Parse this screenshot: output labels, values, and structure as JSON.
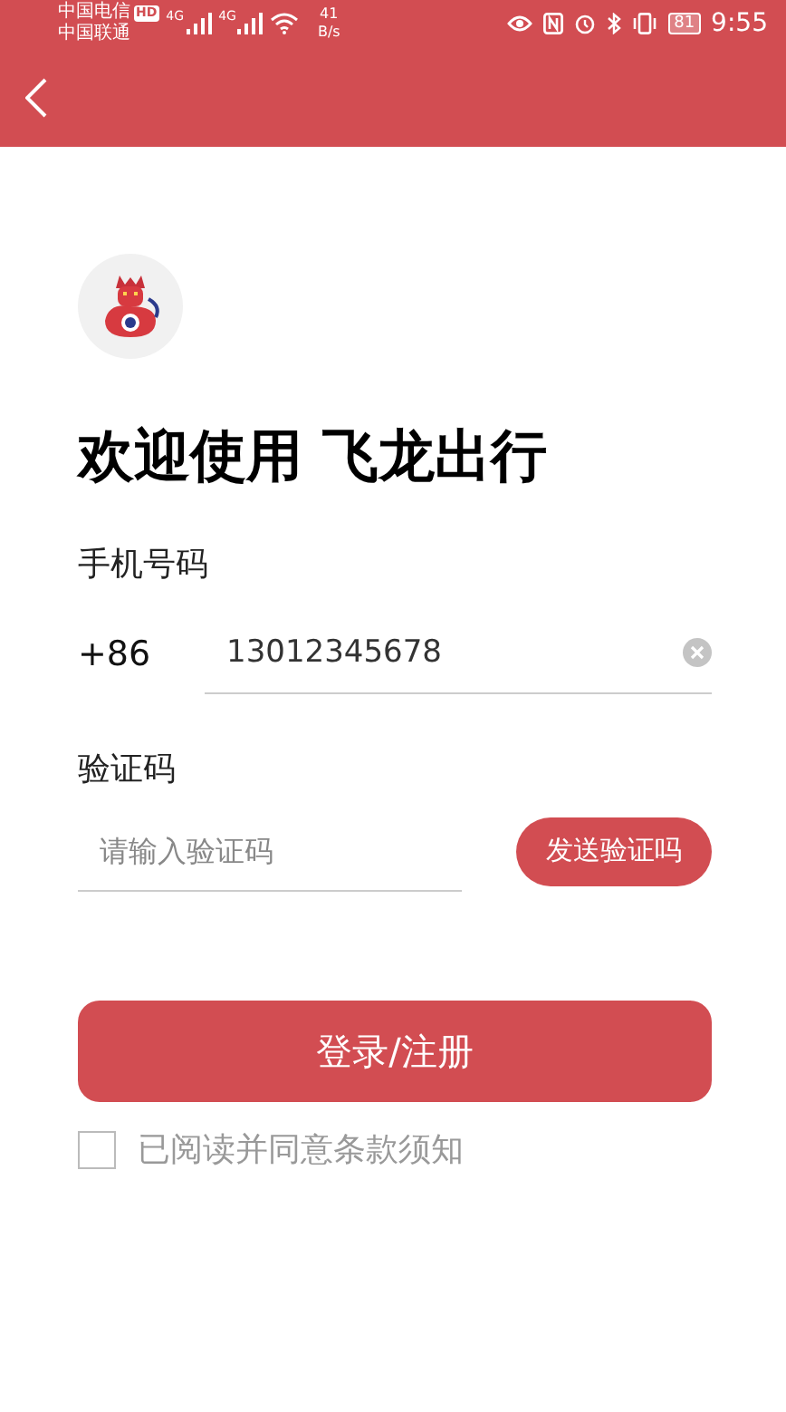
{
  "status_bar": {
    "carrier_1": "中国电信",
    "hd_badge": "HD",
    "network_1": "4G",
    "network_2": "4G",
    "speed": "41",
    "speed_unit": "B/s",
    "carrier_2": "中国联通",
    "battery": "81",
    "time": "9:55"
  },
  "title": "欢迎使用 飞龙出行",
  "phone": {
    "label": "手机号码",
    "country_code": "+86",
    "value": "13012345678"
  },
  "code": {
    "label": "验证码",
    "placeholder": "请输入验证码",
    "send_button": "发送验证吗"
  },
  "login_button": "登录/注册",
  "agreement": {
    "label": "已阅读并同意条款须知",
    "checked": false
  }
}
